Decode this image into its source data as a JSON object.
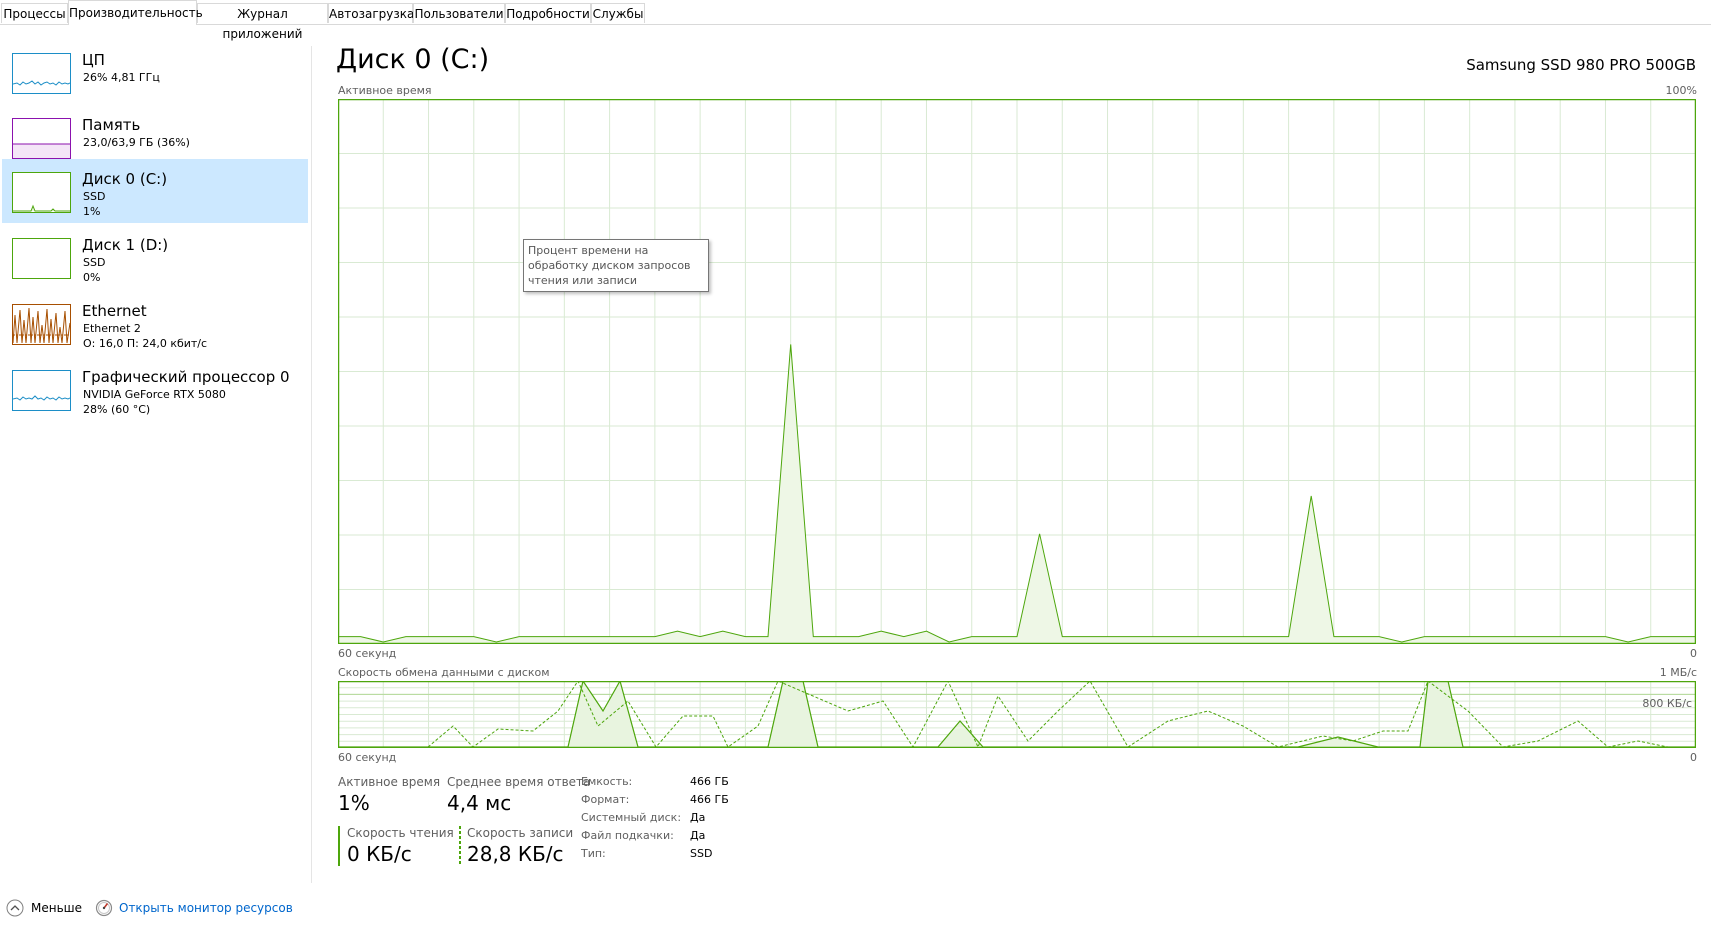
{
  "tabs": [
    "Процессы",
    "Производительность",
    "Журнал приложений",
    "Автозагрузка",
    "Пользователи",
    "Подробности",
    "Службы"
  ],
  "active_tab": "Производительность",
  "sidebar": {
    "items": [
      {
        "title": "ЦП",
        "sub1": "26% 4,81 ГГц",
        "sub2": "",
        "color": "#1c8ec7",
        "selected": false
      },
      {
        "title": "Память",
        "sub1": "23,0/63,9 ГБ (36%)",
        "sub2": "",
        "color": "#8b12ae",
        "selected": false
      },
      {
        "title": "Диск 0 (C:)",
        "sub1": "SSD",
        "sub2": "1%",
        "color": "#4da60c",
        "selected": true
      },
      {
        "title": "Диск 1 (D:)",
        "sub1": "SSD",
        "sub2": "0%",
        "color": "#4da60c",
        "selected": false
      },
      {
        "title": "Ethernet",
        "sub1": "Ethernet 2",
        "sub2": "О: 16,0 П: 24,0 кбит/с",
        "color": "#a74f01",
        "selected": false
      },
      {
        "title": "Графический процессор 0",
        "sub1": "NVIDIA GeForce RTX 5080",
        "sub2": "28% (60 °C)",
        "color": "#1c8ec7",
        "selected": false
      }
    ]
  },
  "main": {
    "title": "Диск 0 (C:)",
    "model": "Samsung SSD 980 PRO 500GB",
    "active_chart": {
      "label": "Активное время",
      "max_label": "100%",
      "time_label": "60 секунд",
      "zero_label": "0",
      "tooltip": "Процент времени на обработку диском запросов чтения или записи"
    },
    "transfer_chart": {
      "label": "Скорость обмена данными с диском",
      "max_label": "1 МБ/с",
      "mid_label": "800 КБ/с",
      "time_label": "60 секунд",
      "zero_label": "0"
    },
    "stats": {
      "active_time_label": "Активное время",
      "active_time_value": "1%",
      "avg_response_label": "Среднее время ответа",
      "avg_response_value": "4,4 мс",
      "read_label": "Скорость чтения",
      "read_value": "0 КБ/с",
      "write_label": "Скорость записи",
      "write_value": "28,8 КБ/с"
    },
    "properties": [
      {
        "key": "Емкость:",
        "value": "466 ГБ"
      },
      {
        "key": "Формат:",
        "value": "466 ГБ"
      },
      {
        "key": "Системный диск:",
        "value": "Да"
      },
      {
        "key": "Файл подкачки:",
        "value": "Да"
      },
      {
        "key": "Тип:",
        "value": "SSD"
      }
    ]
  },
  "footer": {
    "less_label": "Меньше",
    "resmon_label": "Открыть монитор ресурсов"
  },
  "colors": {
    "disk_green": "#4da60c",
    "grid": "#d9ead3",
    "selected_bg": "#cce8ff",
    "link_blue": "#0066cc"
  },
  "chart_data": [
    {
      "type": "area",
      "title": "Активное время",
      "ylim": [
        0,
        100
      ],
      "xlabel": "60 секунд",
      "series": [
        {
          "values": [
            1,
            1,
            0,
            1,
            1,
            1,
            1,
            0,
            1,
            1,
            1,
            1,
            1,
            1,
            1,
            2,
            1,
            2,
            1,
            1,
            0,
            1,
            1,
            1,
            2,
            1,
            2,
            0,
            1,
            1,
            1,
            1,
            1,
            1,
            1,
            1,
            1,
            1,
            1,
            1,
            1,
            1,
            1,
            1,
            1,
            1,
            1,
            0,
            1,
            1,
            1,
            1,
            1,
            1,
            1,
            1,
            1,
            0,
            1,
            1,
            1
          ]
        }
      ]
    },
    {
      "type": "line",
      "title": "Скорость обмена данными с диском",
      "ylim": [
        0,
        1000
      ],
      "ylabel": "1 МБ/с",
      "xlabel": "60 секунд"
    }
  ]
}
